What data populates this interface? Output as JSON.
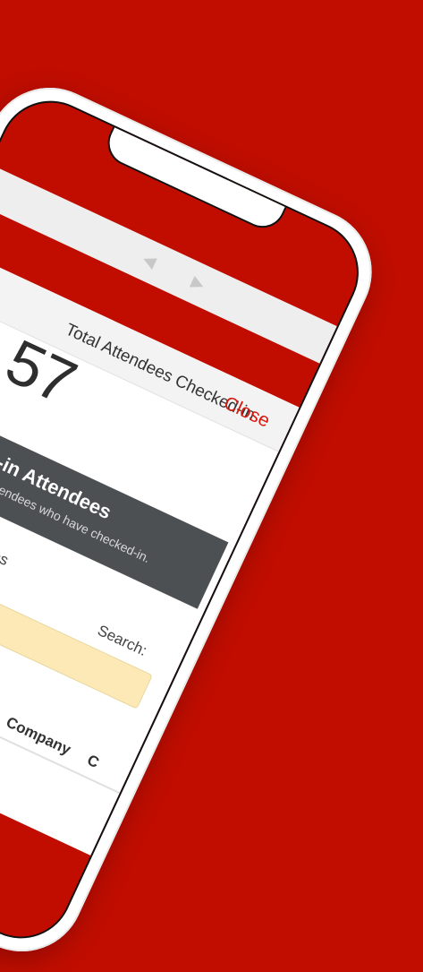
{
  "browser": {
    "back_icon": "◀",
    "forward_icon": "▶"
  },
  "modal": {
    "stat_label": "Total Attendees Checked-in",
    "stat_value": "57",
    "close_label": "Close"
  },
  "banner": {
    "title": "ked-in Attendees",
    "subtitle": "xport attendees who have checked-in."
  },
  "table": {
    "entries_label": "entries",
    "search_label": "Search:",
    "columns": [
      "Company",
      "C"
    ]
  },
  "colors": {
    "brand_red": "#c00d00",
    "banner_gray": "#4d5052",
    "search_bg": "#fde9b6"
  }
}
